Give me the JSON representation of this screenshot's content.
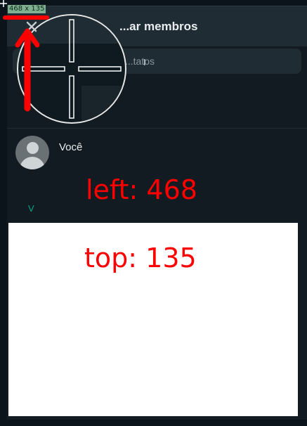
{
  "header": {
    "title": "...ar membros",
    "close_icon": "close-icon"
  },
  "search": {
    "placeholder": "...tatos"
  },
  "contacts": [
    {
      "name": "Você",
      "avatar_icon": "default-avatar-icon"
    }
  ],
  "section": {
    "letter": "V"
  },
  "annotations": {
    "size_label": "468 x 135",
    "left_label": "left: 468",
    "top_label": "top: 135",
    "color": "#ff0000"
  },
  "colors": {
    "panel_bg": "#111b21",
    "header_bg": "#202c33",
    "accent": "#00a884"
  }
}
